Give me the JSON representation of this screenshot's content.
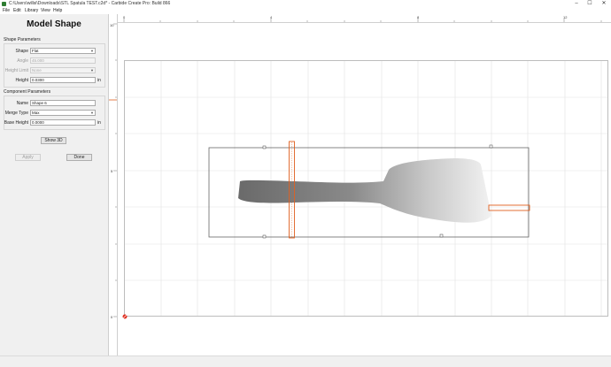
{
  "window": {
    "title": "C:\\Users\\willsi\\Downloads\\STL Spatula TEST.c2d* - Carbide Create Pro: Build 866",
    "controls": [
      "–",
      "☐",
      "✕"
    ]
  },
  "menu": [
    "File",
    "Edit",
    "Library",
    "View",
    "Help"
  ],
  "panel": {
    "title": "Model Shape",
    "shape_section": {
      "label": "Shape Parameters",
      "shape_label": "Shape",
      "shape_value": "Flat",
      "angle_label": "Angle",
      "angle_value": "45.000",
      "height_limit_label": "Height Limit",
      "height_limit_value": "None",
      "height_label": "Height",
      "height_value": "0.0300",
      "height_unit": "in"
    },
    "component_section": {
      "label": "Component Parameters",
      "name_label": "Name",
      "name_value": "Shape 6",
      "merge_label": "Merge Type",
      "merge_value": "Max",
      "base_label": "Base Height",
      "base_value": "0.0000",
      "base_unit": "in"
    },
    "show3d_label": "Show 3D",
    "apply_label": "Apply",
    "done_label": "Done"
  },
  "rulers": {
    "horizontal_ticks": [
      "0",
      "4",
      "8",
      "12"
    ],
    "vertical_ticks": [
      "10",
      "5",
      "0"
    ]
  },
  "colors": {
    "selection": "#e06020",
    "outline": "#666666",
    "grid": "#e2e2e2",
    "origin": "#e03020"
  }
}
